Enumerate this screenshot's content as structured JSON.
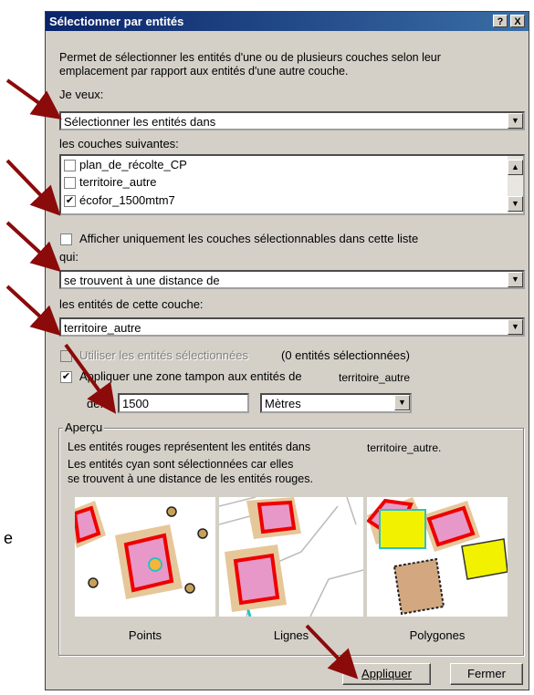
{
  "window": {
    "title": "Sélectionner par entités",
    "help_btn": "?",
    "close_btn": "X"
  },
  "intro": {
    "line1": "Permet de sélectionner les entités d'une ou de plusieurs couches selon leur",
    "line2": "emplacement par rapport aux entités d'une autre couche."
  },
  "method": {
    "label": "Je veux:",
    "value": "Sélectionner les entités dans"
  },
  "layers": {
    "label": "les couches suivantes:",
    "items": [
      {
        "label": "plan_de_récolte_CP",
        "checked": false
      },
      {
        "label": "territoire_autre",
        "checked": false
      },
      {
        "label": "écofor_1500mtm7",
        "checked": true
      }
    ]
  },
  "only_selectable": {
    "label": "Afficher uniquement les couches sélectionnables dans cette liste"
  },
  "relation": {
    "label": "qui:",
    "value": "se trouvent à une distance de"
  },
  "source_layer": {
    "label": "les entités de cette couche:",
    "value": "territoire_autre"
  },
  "use_selected": {
    "label": "Utiliser les entités sélectionnées",
    "count": "(0 entités sélectionnées)"
  },
  "buffer": {
    "label": "Appliquer une zone tampon aux entités de",
    "layer": "territoire_autre",
    "of_label": "de:",
    "distance": "1500",
    "unit": "Mètres"
  },
  "preview": {
    "title": "Aperçu",
    "line1": "Les entités rouges représentent  les entités dans",
    "line1_layer": "territoire_autre.",
    "line2": "Les entités cyan sont sélectionnées car elles",
    "line3": "se trouvent à une distance de les entités rouges.",
    "captions": [
      "Points",
      "Lignes",
      "Polygones"
    ]
  },
  "buttons": {
    "apply": "Appliquer",
    "close": "Fermer"
  },
  "stray_text": "e",
  "colors": {
    "arrow": "#8b0a0a",
    "title_bar": "#0a246a",
    "dialog_bg": "#d4d0c8"
  }
}
